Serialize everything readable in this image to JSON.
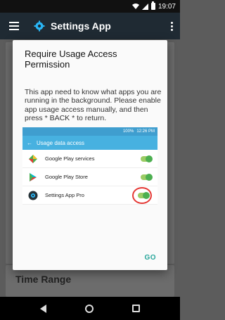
{
  "statusbar": {
    "time": "19:07"
  },
  "appbar": {
    "title": "Settings App"
  },
  "background": {
    "card_title": "Time Range"
  },
  "dialog": {
    "title": "Require Usage Access Permission",
    "message": "This app need to know what apps you are running in the background. Please enable app usage access manually, and then press * BACK * to return.",
    "go_label": "GO",
    "screenshot": {
      "battery_text": "100%",
      "time": "12:26 PM",
      "header": "Usage data access",
      "items": [
        {
          "label": "Google Play services",
          "icon": "google-play-services-icon"
        },
        {
          "label": "Google Play Store",
          "icon": "google-play-store-icon"
        },
        {
          "label": "Settings App Pro",
          "icon": "settings-app-pro-icon"
        }
      ]
    }
  },
  "colors": {
    "accent": "#26a69a",
    "appbar": "#1f2a33",
    "highlight": "#e53935"
  }
}
